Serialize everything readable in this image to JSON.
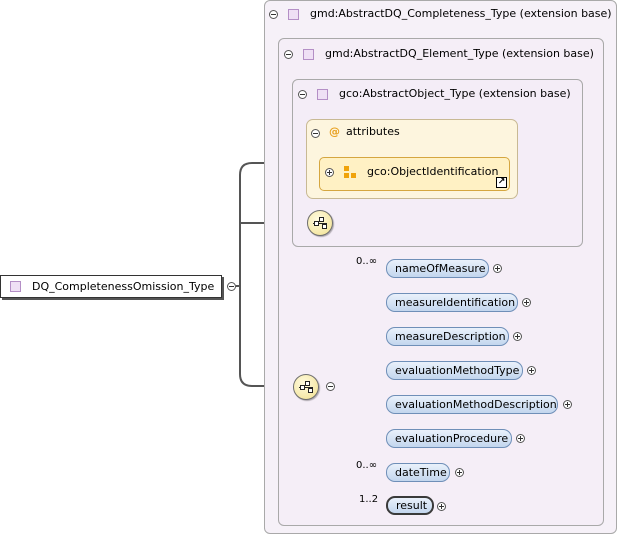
{
  "outer_type": {
    "label": "gmd:AbstractDQ_Completeness_Type (extension base)"
  },
  "element_type": {
    "label": "gmd:AbstractDQ_Element_Type (extension base)"
  },
  "object_type": {
    "label": "gco:AbstractObject_Type (extension base)"
  },
  "attributes": {
    "label": "attributes",
    "icon_glyph": "@",
    "group": {
      "label": "gco:ObjectIdentification",
      "link_glyph": "↗"
    }
  },
  "root": {
    "label": "DQ_CompletenessOmission_Type"
  },
  "sequence": {
    "elements": [
      {
        "name": "nameOfMeasure",
        "occurs": "0..∞",
        "required": false
      },
      {
        "name": "measureIdentification",
        "occurs": "",
        "required": false
      },
      {
        "name": "measureDescription",
        "occurs": "",
        "required": false
      },
      {
        "name": "evaluationMethodType",
        "occurs": "",
        "required": false
      },
      {
        "name": "evaluationMethodDescription",
        "occurs": "",
        "required": false
      },
      {
        "name": "evaluationProcedure",
        "occurs": "",
        "required": false
      },
      {
        "name": "dateTime",
        "occurs": "0..∞",
        "required": false
      },
      {
        "name": "result",
        "occurs": "1..2",
        "required": true
      }
    ]
  },
  "colors": {
    "element_fill": "#c3d6ee",
    "attribute_fill": "#fdf5de",
    "compositor_fill": "#f1e08e",
    "type_icon": "#efe0f5"
  }
}
